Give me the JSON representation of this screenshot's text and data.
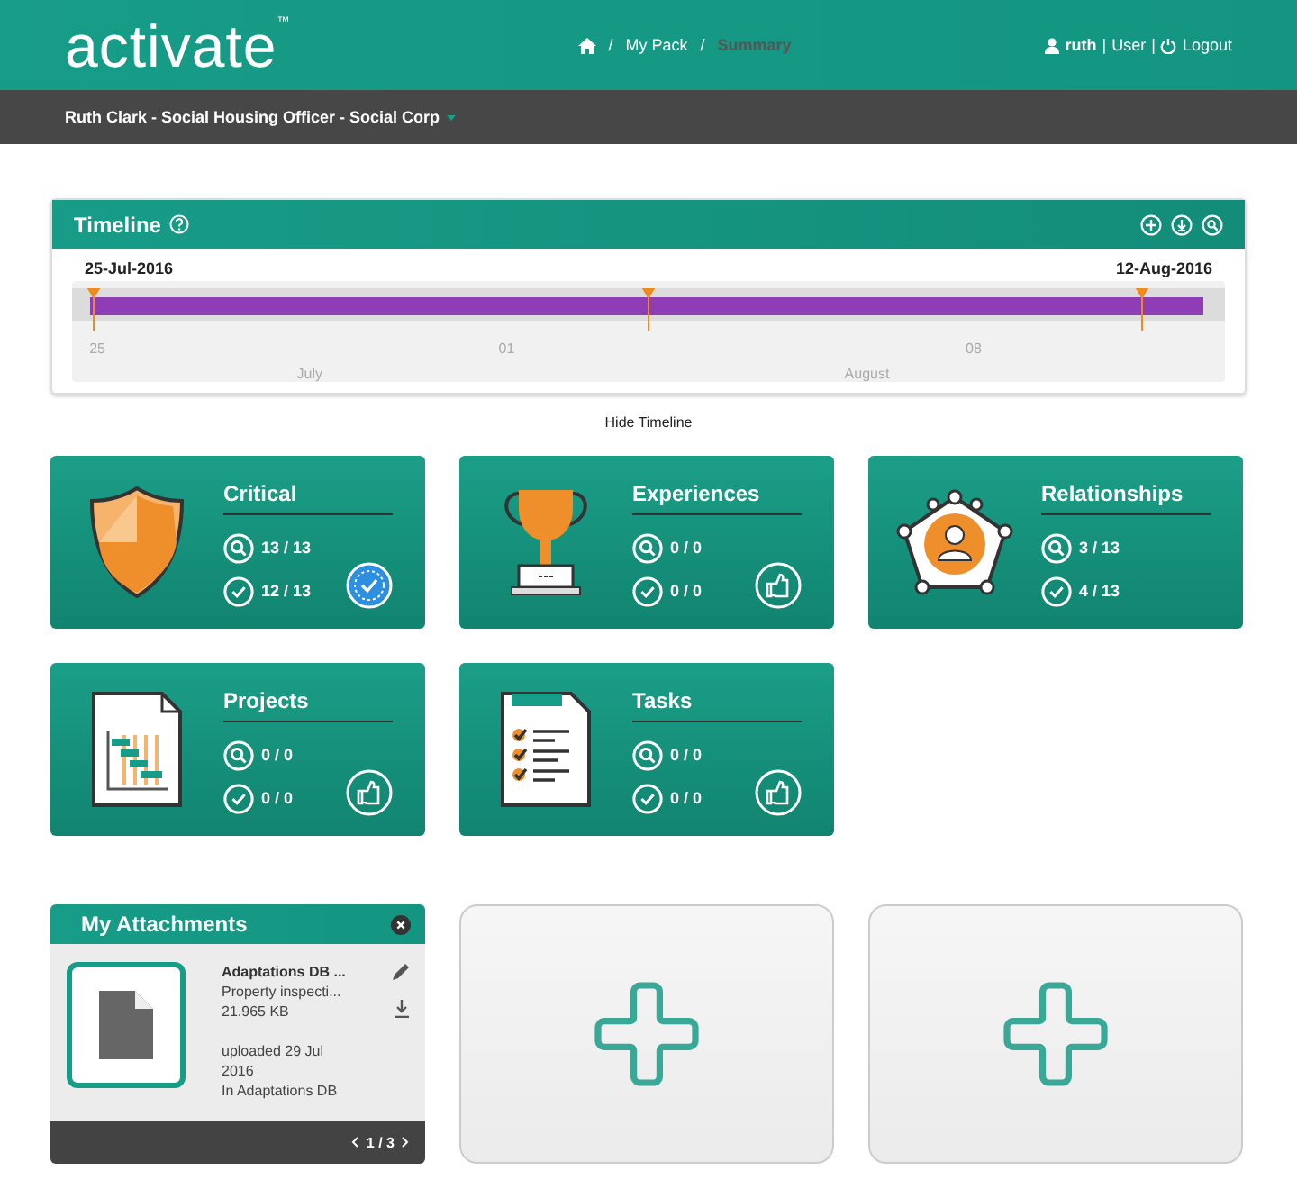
{
  "header": {
    "logo": "activate",
    "logo_mark": "™",
    "breadcrumb_separator": "/",
    "breadcrumbs": [
      {
        "label": "My Pack",
        "current": false
      },
      {
        "label": "Summary",
        "current": true
      }
    ],
    "user": {
      "name": "ruth",
      "divider": "|",
      "role": "User",
      "logout": "Logout"
    }
  },
  "context_bar": {
    "text": "Ruth Clark - Social Housing Officer - Social Corp"
  },
  "timeline": {
    "title": "Timeline",
    "start": "25-Jul-2016",
    "end": "12-Aug-2016",
    "day_ticks": [
      "25",
      "01",
      "08"
    ],
    "months": [
      "July",
      "August"
    ],
    "toggle": "Hide Timeline"
  },
  "tiles": [
    {
      "title": "Critical",
      "search_count": "13 / 13",
      "done_count": "12 / 13",
      "badge": {
        "kind": "verified"
      }
    },
    {
      "title": "Experiences",
      "search_count": "0 / 0",
      "done_count": "0 / 0",
      "badge": {
        "kind": "thumbs"
      }
    },
    {
      "title": "Relationships",
      "search_count": "3 / 13",
      "done_count": "4 / 13"
    },
    {
      "title": "Projects",
      "search_count": "0 / 0",
      "done_count": "0 / 0",
      "badge": {
        "kind": "thumbs"
      }
    },
    {
      "title": "Tasks",
      "search_count": "0 / 0",
      "done_count": "0 / 0",
      "badge": {
        "kind": "thumbs"
      }
    }
  ],
  "attachments": {
    "title": "My Attachments",
    "file_name": "Adaptations DB ...",
    "description": "Property inspecti...",
    "size": "21.965 KB",
    "uploaded": "uploaded 29 Jul 2016",
    "location": "In Adaptations DB",
    "pager": "1 / 3"
  },
  "add_slots": [
    {
      "kind": "add"
    },
    {
      "kind": "add"
    }
  ]
}
